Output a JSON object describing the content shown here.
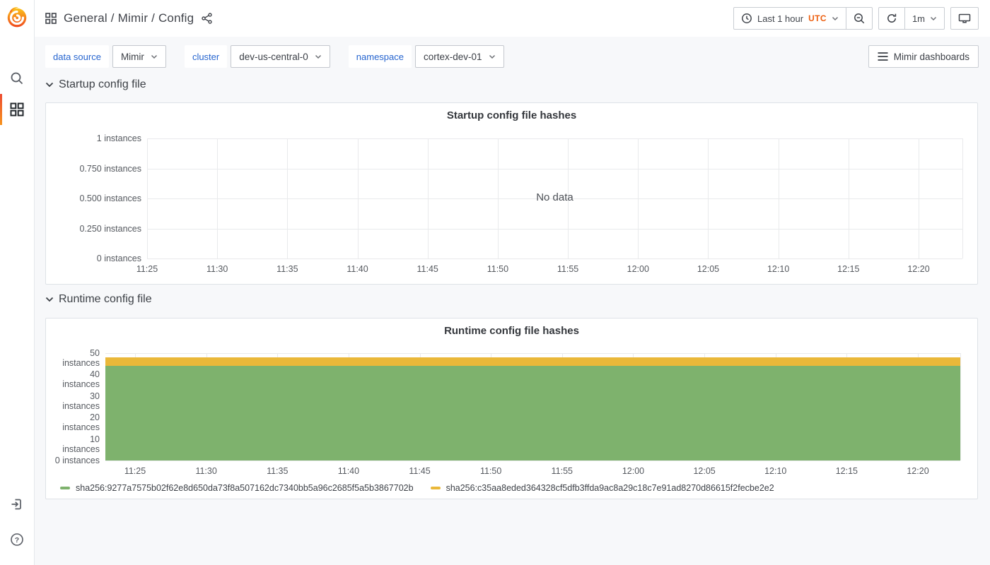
{
  "header": {
    "breadcrumb": "General / Mimir / Config",
    "time_range": "Last 1 hour",
    "timezone": "UTC",
    "refresh_interval": "1m"
  },
  "icons": {
    "sidebar": [
      "grafana-logo",
      "search-icon",
      "dashboards-grid-icon",
      "sign-in-icon",
      "help-icon"
    ],
    "header": [
      "apps-grid-icon",
      "share-icon",
      "clock-icon",
      "chevron-down-icon",
      "zoom-out-icon",
      "refresh-icon",
      "monitor-icon"
    ],
    "colors": {
      "accent_orange": "#ed5f0f",
      "link_blue": "#2564cf",
      "active_bar": "linear red-orange"
    }
  },
  "filters": {
    "variables": [
      {
        "label": "data source",
        "value": "Mimir"
      },
      {
        "label": "cluster",
        "value": "dev-us-central-0"
      },
      {
        "label": "namespace",
        "value": "cortex-dev-01"
      }
    ],
    "dashboards_button": "Mimir dashboards"
  },
  "sections": [
    {
      "title": "Startup config file"
    },
    {
      "title": "Runtime config file"
    }
  ],
  "chart_data": [
    {
      "type": "line",
      "title": "Startup config file hashes",
      "no_data_text": "No data",
      "grid": true,
      "ylim": [
        0,
        1
      ],
      "y_ticks": [
        "1 instances",
        "0.750 instances",
        "0.500 instances",
        "0.250 instances",
        "0 instances"
      ],
      "x_ticks": [
        "11:25",
        "11:30",
        "11:35",
        "11:40",
        "11:45",
        "11:50",
        "11:55",
        "12:00",
        "12:05",
        "12:10",
        "12:15",
        "12:20"
      ],
      "series": []
    },
    {
      "type": "area",
      "stacked": true,
      "title": "Runtime config file hashes",
      "grid": true,
      "ylim": [
        0,
        50
      ],
      "y_ticks": [
        "50 instances",
        "40 instances",
        "30 instances",
        "20 instances",
        "10 instances",
        "0 instances"
      ],
      "x_ticks": [
        "11:25",
        "11:30",
        "11:35",
        "11:40",
        "11:45",
        "11:50",
        "11:55",
        "12:00",
        "12:05",
        "12:10",
        "12:15",
        "12:20"
      ],
      "legend_position": "bottom",
      "series": [
        {
          "name": "sha256:9277a7575b02f62e8d650da73f8a507162dc7340bb5a96c2685f5a5b3867702b",
          "color": "#7EB26D",
          "value": 44
        },
        {
          "name": "sha256:c35aa8eded364328cf5dfb3ffda9ac8a29c18c7e91ad8270d86615f2fecbe2e2",
          "color": "#EAB839",
          "value": 4
        }
      ]
    }
  ]
}
